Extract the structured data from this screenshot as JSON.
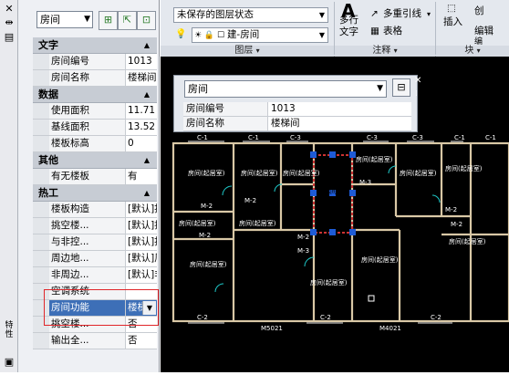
{
  "left_strip": {
    "icons": [
      "close-icon",
      "collapse-icon",
      "properties-icon"
    ],
    "vertical_label": "特性"
  },
  "palette": {
    "selector_value": "房间",
    "toolbar_icons": [
      "quick-select-icon",
      "select-objects-icon",
      "toggle-pickadd-icon"
    ],
    "sections": [
      {
        "title": "文字",
        "rows": [
          {
            "key": "房间编号",
            "value": "1013"
          },
          {
            "key": "房间名称",
            "value": "楼梯间"
          }
        ]
      },
      {
        "title": "数据",
        "rows": [
          {
            "key": "使用面积",
            "value": "11.71"
          },
          {
            "key": "基线面积",
            "value": "13.52"
          },
          {
            "key": "楼板标高",
            "value": "0"
          }
        ]
      },
      {
        "title": "其他",
        "rows": [
          {
            "key": "有无楼板",
            "value": "有"
          }
        ]
      },
      {
        "title": "热工",
        "rows": [
          {
            "key": "楼板构造",
            "value": "[默认]控温..."
          },
          {
            "key": "挑空楼...",
            "value": "[默认]挑空..."
          },
          {
            "key": "与非控...",
            "value": "[默认]控温..."
          },
          {
            "key": "周边地...",
            "value": "[默认]周边..."
          },
          {
            "key": "非周边...",
            "value": "[默认]非周..."
          },
          {
            "key": "空调系统",
            "value": ""
          },
          {
            "key": "房间功能",
            "value": "楼梯间",
            "selected": true
          },
          {
            "key": "挑空楼...",
            "value": "否"
          },
          {
            "key": "输出全...",
            "value": "否"
          }
        ]
      }
    ]
  },
  "ribbon": {
    "layer_state": "未保存的图层状态",
    "layer_current": "建-房间",
    "layer_group": "图层",
    "multiline_text": "多行",
    "multiline_text2": "文字",
    "multileader": "多重引线",
    "table": "表格",
    "annotation_group": "注释",
    "insert": "插入",
    "create": "创",
    "edit": "编辑",
    "edit_attr": "编",
    "block_group": "块"
  },
  "dialog": {
    "selector_value": "房间",
    "rows": [
      {
        "key": "房间编号",
        "value": "1013"
      },
      {
        "key": "房间名称",
        "value": "楼梯间"
      }
    ]
  },
  "drawing": {
    "room_label": "房间(起居室)",
    "stair_label": "楼梯间",
    "labels_top": [
      "C-1",
      "C-1",
      "C-3",
      "C-3",
      "C-3",
      "C-1",
      "C-1"
    ],
    "labels_misc": [
      "M-2",
      "M-2",
      "M-3",
      "M-2",
      "M-2",
      "M-2",
      "M-2",
      "M-3",
      "C-2",
      "C-2",
      "C-2",
      "M5021",
      "M4021"
    ]
  },
  "colors": {
    "accent_selected": "#3d6fb7",
    "highlight_box": "#e0262a",
    "wall": "#d9c8a6",
    "wall_fill": "#cc3333",
    "grip": "#1e5bd6"
  }
}
